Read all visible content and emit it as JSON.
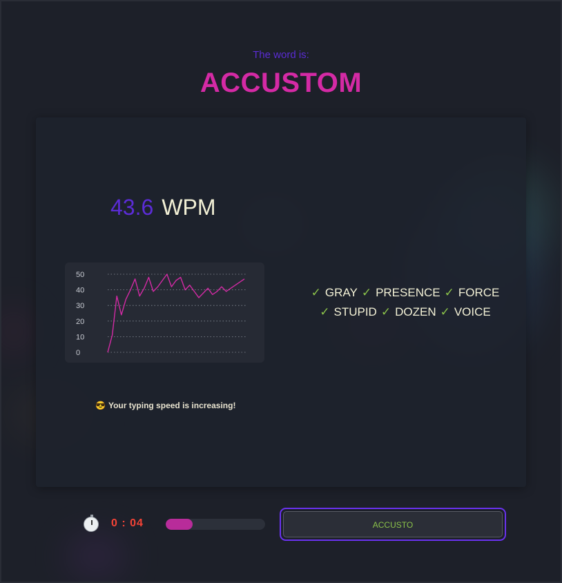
{
  "header": {
    "label": "The word is:",
    "word": "ACCUSTOM"
  },
  "stats": {
    "wpm_value": "43.6",
    "wpm_unit": "WPM"
  },
  "chart_data": {
    "type": "line",
    "title": "",
    "xlabel": "",
    "ylabel": "",
    "ylim": [
      0,
      50
    ],
    "yticks": [
      0,
      10,
      20,
      30,
      40,
      50
    ],
    "grid": true,
    "legend": "none",
    "series": [
      {
        "color": "#d42aa5",
        "values": [
          0,
          11,
          36,
          24,
          34,
          40,
          47,
          36,
          41,
          48,
          39,
          42,
          46,
          50,
          42,
          46,
          48,
          40,
          43,
          39,
          35,
          38,
          41,
          37,
          39,
          42,
          39,
          41,
          43,
          45,
          47
        ]
      }
    ]
  },
  "completed_words": {
    "rows": [
      [
        "GRAY",
        "PRESENCE",
        "FORCE"
      ],
      [
        "STUPID",
        "DOZEN",
        "VOICE"
      ]
    ],
    "check_color": "#8bc34a"
  },
  "feedback": {
    "emoji": "😎",
    "text": "Your typing speed is increasing!"
  },
  "timer": {
    "text": "0 : 04",
    "progress": 0.27
  },
  "input": {
    "value": "ACCUSTO"
  },
  "colors": {
    "accent": "#5b2cd6",
    "word": "#d42aa5",
    "timer": "#f44336",
    "success": "#8bc34a",
    "input_border": "#6a32f0"
  }
}
